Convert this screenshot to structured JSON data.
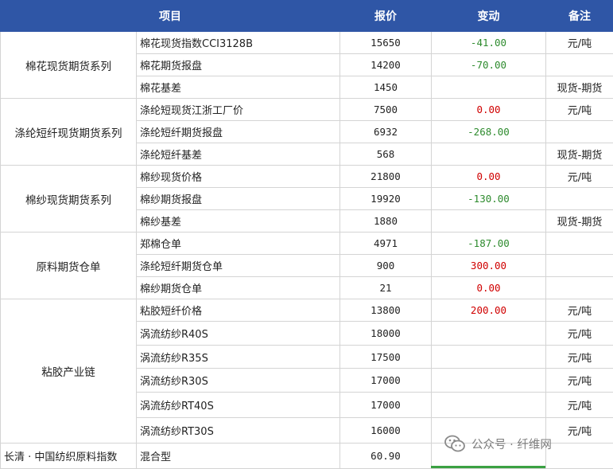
{
  "header": {
    "item": "项目",
    "price": "报价",
    "change": "变动",
    "note": "备注"
  },
  "groups": [
    {
      "category": "棉花现货期货系列",
      "rows": [
        {
          "item": "棉花现货指数CCI3128B",
          "price": "15650",
          "change": "-41.00",
          "dir": "neg",
          "note": "元/吨"
        },
        {
          "item": "棉花期货报盘",
          "price": "14200",
          "change": "-70.00",
          "dir": "neg",
          "note": ""
        },
        {
          "item": "棉花基差",
          "price": "1450",
          "change": "",
          "dir": "",
          "note": "现货-期货"
        }
      ]
    },
    {
      "category": "涤纶短纤现货期货系列",
      "rows": [
        {
          "item": "涤纶短现货江浙工厂价",
          "price": "7500",
          "change": "0.00",
          "dir": "pos",
          "note": "元/吨"
        },
        {
          "item": "涤纶短纤期货报盘",
          "price": "6932",
          "change": "-268.00",
          "dir": "neg",
          "note": ""
        },
        {
          "item": "涤纶短纤基差",
          "price": "568",
          "change": "",
          "dir": "",
          "note": "现货-期货"
        }
      ]
    },
    {
      "category": "棉纱现货期货系列",
      "rows": [
        {
          "item": "棉纱现货价格",
          "price": "21800",
          "change": "0.00",
          "dir": "pos",
          "note": "元/吨"
        },
        {
          "item": "棉纱期货报盘",
          "price": "19920",
          "change": "-130.00",
          "dir": "neg",
          "note": ""
        },
        {
          "item": "棉纱基差",
          "price": "1880",
          "change": "",
          "dir": "",
          "note": "现货-期货"
        }
      ]
    },
    {
      "category": "原料期货仓单",
      "rows": [
        {
          "item": "郑棉仓单",
          "price": "4971",
          "change": "-187.00",
          "dir": "neg",
          "note": ""
        },
        {
          "item": "涤纶短纤期货仓单",
          "price": "900",
          "change": "300.00",
          "dir": "pos",
          "note": ""
        },
        {
          "item": "棉纱期货仓单",
          "price": "21",
          "change": "0.00",
          "dir": "pos",
          "note": ""
        }
      ]
    },
    {
      "category": "粘胶产业链",
      "rows": [
        {
          "item": "粘胶短纤价格",
          "price": "13800",
          "change": "200.00",
          "dir": "pos",
          "note": "元/吨"
        },
        {
          "item": "涡流纺纱R40S",
          "price": "18000",
          "change": "",
          "dir": "",
          "note": "元/吨"
        },
        {
          "item": "涡流纺纱R35S",
          "price": "17500",
          "change": "",
          "dir": "",
          "note": "元/吨"
        },
        {
          "item": "涡流纺纱R30S",
          "price": "17000",
          "change": "",
          "dir": "",
          "note": "元/吨"
        },
        {
          "item": "涡流纺纱RT40S",
          "price": "17000",
          "change": "",
          "dir": "",
          "note": "元/吨"
        },
        {
          "item": "涡流纺纱RT30S",
          "price": "16000",
          "change": "",
          "dir": "",
          "note": "元/吨"
        }
      ]
    }
  ],
  "footer": {
    "label": "长清 · 中国纺织原料指数",
    "item": "混合型",
    "price": "60.90"
  },
  "watermark": {
    "icon": "wechat-icon",
    "text": "公众号 · 纤维网"
  },
  "colors": {
    "header_bg": "#2f56a6",
    "negative": "#2e8b2e",
    "positive": "#d00000",
    "footer_bar": "#3aa142"
  }
}
